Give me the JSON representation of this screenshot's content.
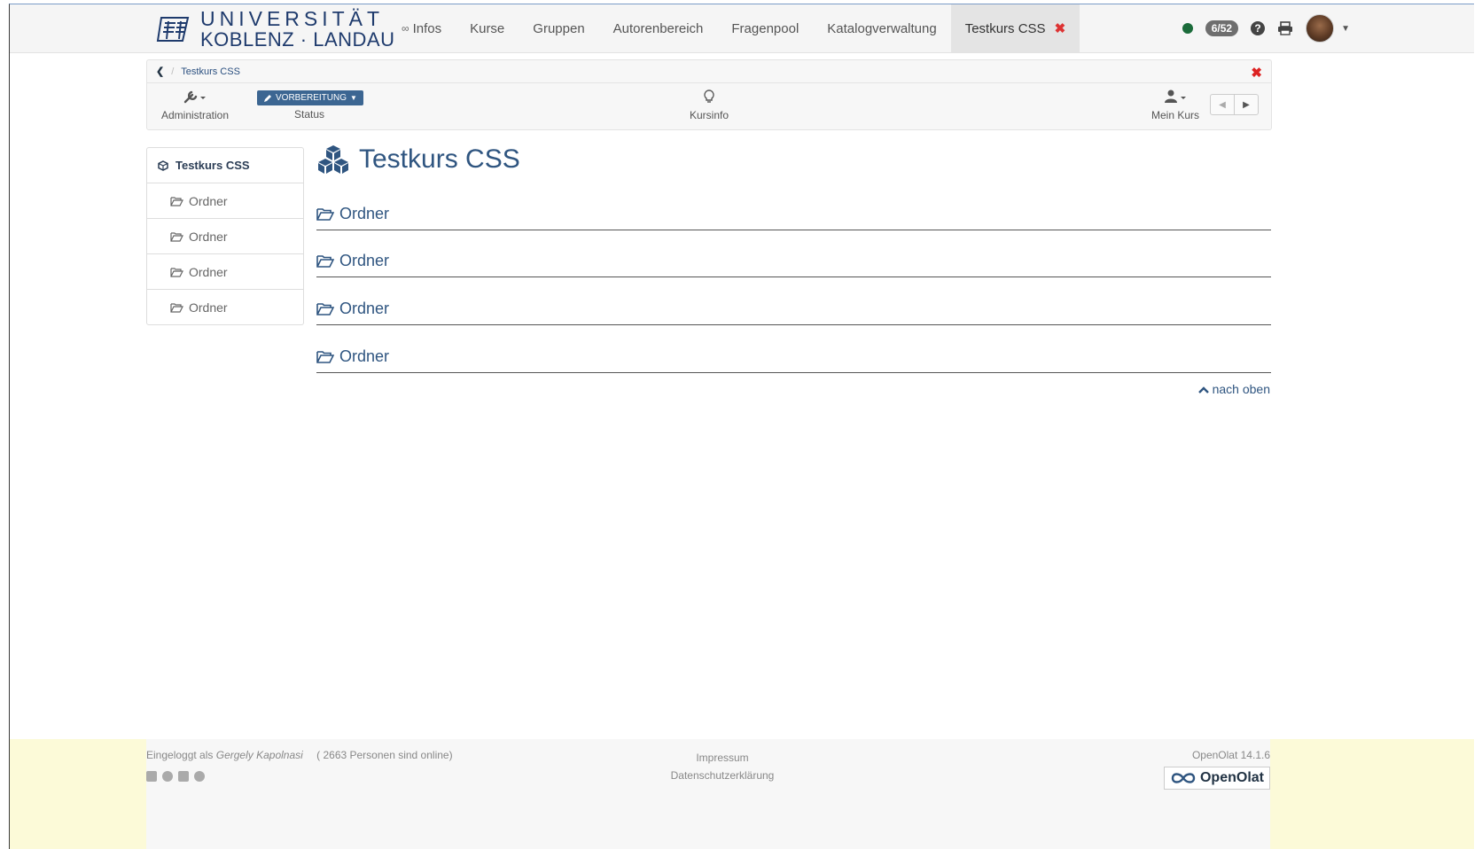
{
  "logo": {
    "line1": "UNIVERSITÄT",
    "line2": "KOBLENZ · LANDAU"
  },
  "nav": {
    "items": [
      {
        "label": "Infos"
      },
      {
        "label": "Kurse"
      },
      {
        "label": "Gruppen"
      },
      {
        "label": "Autorenbereich"
      },
      {
        "label": "Fragenpool"
      },
      {
        "label": "Katalogverwaltung"
      }
    ],
    "active_tab": {
      "label": "Testkurs CSS",
      "close": "✖"
    },
    "infinity_symbol": "∞",
    "online_badge": "6/52",
    "help": "?"
  },
  "toolbar": {
    "back": "❮",
    "separator": "/",
    "breadcrumb": "Testkurs CSS",
    "close": "✖",
    "administration": "Administration",
    "status_button": "VORBEREITUNG",
    "status_label": "Status",
    "kursinfo": "Kursinfo",
    "mein_kurs": "Mein Kurs"
  },
  "sidebar": {
    "title": "Testkurs CSS",
    "items": [
      {
        "label": "Ordner"
      },
      {
        "label": "Ordner"
      },
      {
        "label": "Ordner"
      },
      {
        "label": "Ordner"
      }
    ]
  },
  "main": {
    "title": "Testkurs CSS",
    "folders": [
      {
        "label": "Ordner"
      },
      {
        "label": "Ordner"
      },
      {
        "label": "Ordner"
      },
      {
        "label": "Ordner"
      }
    ],
    "back_to_top": "nach oben"
  },
  "footer": {
    "logged_in_prefix": "Eingeloggt als",
    "user": "Gergely Kapolnasi",
    "online_count": "( 2663 Personen sind online)",
    "impressum": "Impressum",
    "privacy": "Datenschutzerklärung",
    "version": "OpenOlat 14.1.6",
    "brand": "OpenOlat"
  },
  "colors": {
    "accent": "#2f5580",
    "status_button": "#3c6692",
    "close_red": "#d22222",
    "online_dot": "#1b6b3a",
    "footer_bg": "#fcfad8"
  }
}
